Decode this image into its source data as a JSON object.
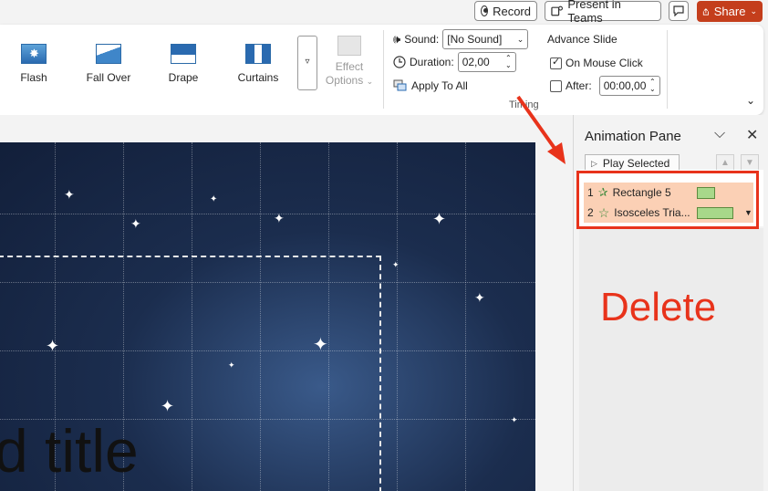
{
  "topbar": {
    "record_label": "Record",
    "teams_label": "Present in Teams",
    "share_label": "Share"
  },
  "ribbon": {
    "transitions": [
      {
        "label": "Flash",
        "icon": "flash-transition-icon"
      },
      {
        "label": "Fall Over",
        "icon": "fall-over-transition-icon"
      },
      {
        "label": "Drape",
        "icon": "drape-transition-icon"
      },
      {
        "label": "Curtains",
        "icon": "curtains-transition-icon"
      }
    ],
    "effect_options_line1": "Effect",
    "effect_options_line2": "Options",
    "sound_label": "Sound:",
    "sound_value": "[No Sound]",
    "duration_label": "Duration:",
    "duration_value": "02,00",
    "apply_all_label": "Apply To All",
    "advance_slide_label": "Advance Slide",
    "on_mouse_click_label": "On Mouse Click",
    "on_mouse_click_checked": true,
    "after_label": "After:",
    "after_checked": false,
    "after_value": "00:00,00",
    "timing_group_label": "Timing"
  },
  "slide": {
    "title_text": "d title"
  },
  "animation_pane": {
    "title": "Animation Pane",
    "play_selected_label": "Play Selected",
    "items": [
      {
        "index": "1",
        "name": "Rectangle 5",
        "icon": "emphasis-star-icon"
      },
      {
        "index": "2",
        "name": "Isosceles Tria...",
        "icon": "entrance-star-icon"
      }
    ]
  },
  "annotation": {
    "delete_text": "Delete",
    "highlight_color": "#e8331b"
  }
}
